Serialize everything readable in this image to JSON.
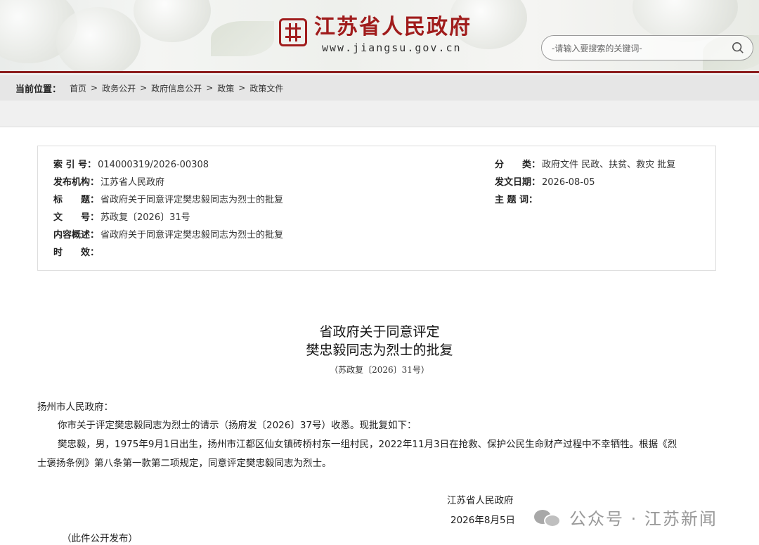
{
  "header": {
    "site_title": "江苏省人民政府",
    "site_url": "www.jiangsu.gov.cn",
    "search_placeholder": "-请输入要搜索的关键词-",
    "brand_color": "#a01c1c"
  },
  "breadcrumb": {
    "label": "当前位置：",
    "items": [
      "首页",
      "政务公开",
      "政府信息公开",
      "政策",
      "政策文件"
    ],
    "separator": ">"
  },
  "info": {
    "index_label": "索 引 号：",
    "index_value": "014000319/2026-00308",
    "publisher_label": "发布机构：",
    "publisher_value": "江苏省人民政府",
    "title_label": "标　　题：",
    "title_value": "省政府关于同意评定樊忠毅同志为烈士的批复",
    "docno_label": "文　　号：",
    "docno_value": "苏政复〔2026〕31号",
    "summary_label": "内容概述：",
    "summary_value": "省政府关于同意评定樊忠毅同志为烈士的批复",
    "validity_label": "时　　效：",
    "validity_value": "",
    "category_label": "分　　类：",
    "category_value": "政府文件 民政、扶贫、救灾 批复",
    "date_label": "发文日期：",
    "date_value": "2026-08-05",
    "keywords_label": "主 题 词：",
    "keywords_value": ""
  },
  "document": {
    "title_line1": "省政府关于同意评定",
    "title_line2": "樊忠毅同志为烈士的批复",
    "doc_number": "（苏政复〔2026〕31号）",
    "salutation": "扬州市人民政府：",
    "para1": "你市关于评定樊忠毅同志为烈士的请示（扬府发〔2026〕37号）收悉。现批复如下：",
    "para2_line1": "樊忠毅，男，1975年9月1日出生，扬州市江都区仙女镇砖桥村东一组村民，2022年11月3日在抢救、保护公民生命财产过程中不幸牺牲。根据《烈",
    "para2_line2": "士褒扬条例》第八条第一款第二项规定，同意评定樊忠毅同志为烈士。",
    "signer": "江苏省人民政府",
    "sign_date": "2026年8月5日",
    "note": "（此件公开发布）"
  },
  "watermark": {
    "text": "公众号 · 江苏新闻",
    "icon": "wechat-icon"
  }
}
